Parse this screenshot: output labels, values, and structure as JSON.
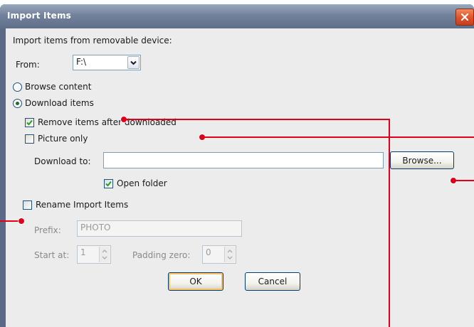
{
  "window": {
    "title": "Import Items"
  },
  "intro": "Import items from removable device:",
  "from": {
    "label": "From:",
    "value": "F:\\"
  },
  "options": {
    "browse_content": "Browse content",
    "download_items": "Download items",
    "remove_after": "Remove items after downloaded",
    "picture_only": "Picture only"
  },
  "download_to": {
    "label": "Download to:",
    "value": "",
    "browse": "Browse..."
  },
  "open_folder": "Open folder",
  "rename": {
    "label": "Rename Import Items",
    "prefix_label": "Prefix:",
    "prefix_value": "PHOTO",
    "start_label": "Start at:",
    "start_value": "1",
    "padding_label": "Padding zero:",
    "padding_value": "0"
  },
  "buttons": {
    "ok": "OK",
    "cancel": "Cancel"
  },
  "state": {
    "browse_content_selected": false,
    "download_items_selected": true,
    "remove_after_checked": true,
    "picture_only_checked": false,
    "open_folder_checked": true,
    "rename_checked": false
  },
  "colors": {
    "callout": "#e0001b",
    "titlebar": "#6f7f99"
  }
}
